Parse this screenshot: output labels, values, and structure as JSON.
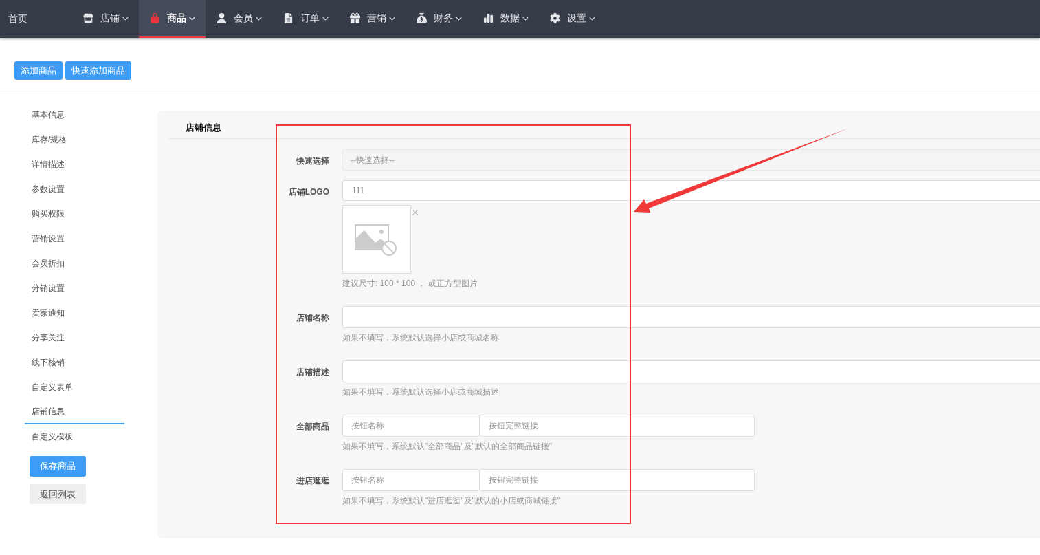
{
  "nav": {
    "home": "首页",
    "items": [
      {
        "label": "店铺",
        "selected": false
      },
      {
        "label": "商品",
        "selected": true
      },
      {
        "label": "会员",
        "selected": false
      },
      {
        "label": "订单",
        "selected": false
      },
      {
        "label": "营销",
        "selected": false
      },
      {
        "label": "财务",
        "selected": false
      },
      {
        "label": "数据",
        "selected": false
      },
      {
        "label": "设置",
        "selected": false
      }
    ]
  },
  "toolbar": [
    "添加商品",
    "快速添加商品"
  ],
  "sidebar": {
    "items": [
      {
        "label": "基本信息",
        "selected": false
      },
      {
        "label": "库存/规格",
        "selected": false
      },
      {
        "label": "详情描述",
        "selected": false
      },
      {
        "label": "参数设置",
        "selected": false
      },
      {
        "label": "购买权限",
        "selected": false
      },
      {
        "label": "营销设置",
        "selected": false
      },
      {
        "label": "会员折扣",
        "selected": false
      },
      {
        "label": "分销设置",
        "selected": false
      },
      {
        "label": "卖家通知",
        "selected": false
      },
      {
        "label": "分享关注",
        "selected": false
      },
      {
        "label": "线下核销",
        "selected": false
      },
      {
        "label": "自定义表单",
        "selected": false
      },
      {
        "label": "店铺信息",
        "selected": true
      },
      {
        "label": "自定义模板",
        "selected": false
      }
    ],
    "save": "保存商品",
    "back": "返回列表"
  },
  "panel": {
    "title": "店铺信息",
    "rows": [
      {
        "kind": "select",
        "label": "快速选择",
        "placeholder": "--快速选择--"
      },
      {
        "kind": "image",
        "label": "店铺LOGO",
        "value": "111",
        "close": "×",
        "hint": "建议尺寸: 100 * 100 ， 或正方型图片"
      },
      {
        "kind": "text",
        "label": "店铺名称",
        "hint": "如果不填写，系统默认选择小店或商城名称"
      },
      {
        "kind": "text",
        "label": "店铺描述",
        "hint": "如果不填写，系统默认选择小店或商城描述"
      },
      {
        "kind": "pair",
        "label": "全部商品",
        "placeholder": "按钮名称",
        "placeholder2": "按钮完整链接",
        "hint": "如果不填写，系统默认\"全部商品\"及\"默认的全部商品链接\""
      },
      {
        "kind": "pair",
        "label": "进店逛逛",
        "placeholder": "按钮名称",
        "placeholder2": "按钮完整链接",
        "hint": "如果不填写，系统默认\"进店逛逛\"及\"默认的小店或商城链接\""
      }
    ]
  }
}
